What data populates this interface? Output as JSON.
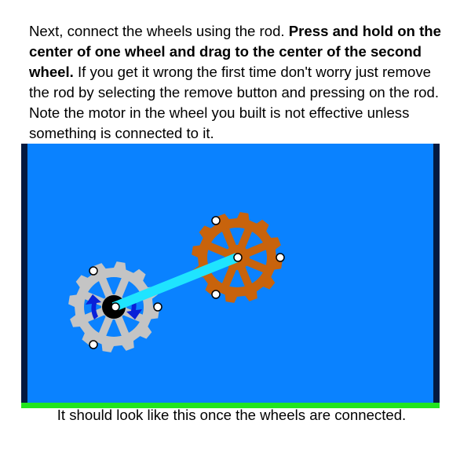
{
  "instructions": {
    "part1": "Next, connect the wheels using the rod. ",
    "bold": "Press and hold on the center of one wheel and drag to the center of the second wheel.",
    "part2": " If you get it wrong the first time don't worry just remove the rod by selecting the remove button and pressing on the rod. Note the motor in the wheel you built is not effective unless something is connected to it."
  },
  "caption": "It should look like this once the wheels are connected.",
  "colors": {
    "sky": "#0a82ff",
    "frame": "#041a40",
    "ground": "#22e51e",
    "wheel_gray": "#c4c4c4",
    "wheel_orange": "#c8630c",
    "rod": "#1fe4ff",
    "motor_arrows": "#0a20d8",
    "hub": "#000000"
  },
  "icons": {
    "gray_wheel": "gear-wheel-icon",
    "orange_wheel": "gear-wheel-icon",
    "motor": "rotate-arrows-icon",
    "joint": "circle-joint-icon"
  }
}
